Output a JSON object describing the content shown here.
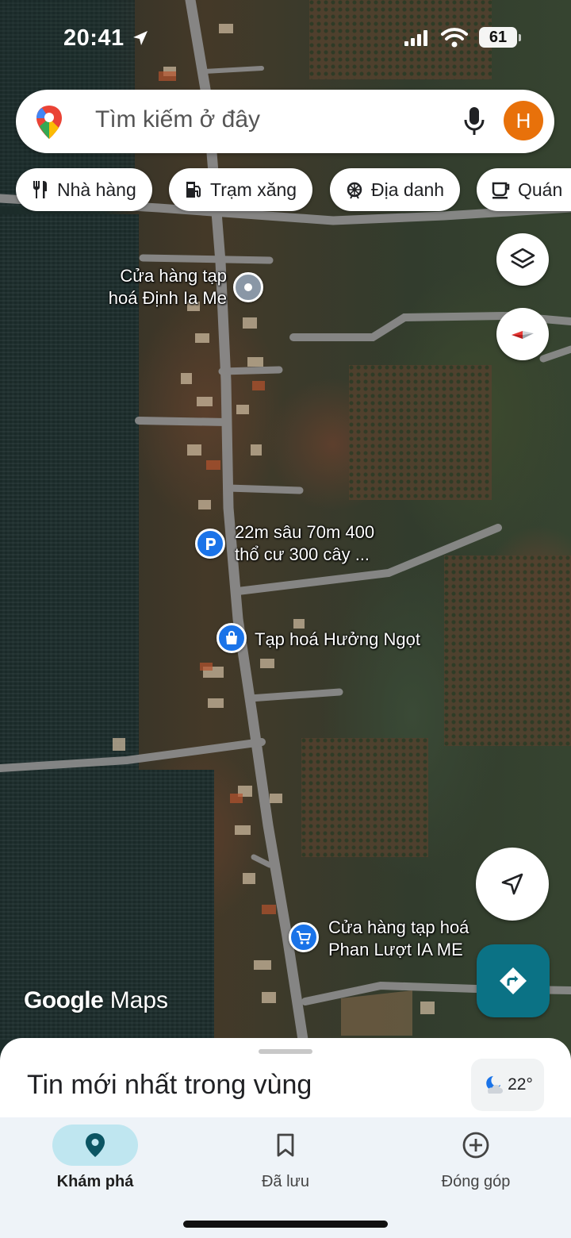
{
  "status_bar": {
    "time": "20:41",
    "battery": "61"
  },
  "search": {
    "placeholder": "Tìm kiếm ở đây",
    "avatar_initial": "H"
  },
  "chips": [
    {
      "label": "Nhà hàng",
      "icon": "fork-knife-icon"
    },
    {
      "label": "Trạm xăng",
      "icon": "gas-station-icon"
    },
    {
      "label": "Địa danh",
      "icon": "landmark-icon"
    },
    {
      "label": "Quán",
      "icon": "coffee-cup-icon"
    }
  ],
  "places": [
    {
      "line1": "Cửa hàng tạp",
      "line2": "hoá Định Ia Me",
      "icon": "place-pin-icon",
      "color": "#8a97a6"
    },
    {
      "line1": "22m sâu 70m 400",
      "line2": "thổ cư 300 cây ...",
      "icon": "parking-icon",
      "color": "#1a73e8"
    },
    {
      "line1": "Tạp hoá Hưởng Ngọt",
      "line2": "",
      "icon": "shopping-bag-icon",
      "color": "#1a73e8"
    },
    {
      "line1": "Cửa hàng tạp hoá",
      "line2": "Phan Lượt IA ME",
      "icon": "shopping-cart-icon",
      "color": "#1a73e8"
    }
  ],
  "watermark": {
    "brand": "Google",
    "product": "Maps"
  },
  "sheet": {
    "title": "Tin mới nhất trong vùng",
    "temperature": "22°"
  },
  "nav": [
    {
      "label": "Khám phá",
      "icon": "explore-pin-icon",
      "active": true
    },
    {
      "label": "Đã lưu",
      "icon": "bookmark-icon",
      "active": false
    },
    {
      "label": "Đóng góp",
      "icon": "add-circle-icon",
      "active": false
    }
  ],
  "colors": {
    "accent": "#1a73e8",
    "directions": "#0b7285",
    "avatar": "#e8710a",
    "nav_active": "#bfe6f0"
  }
}
